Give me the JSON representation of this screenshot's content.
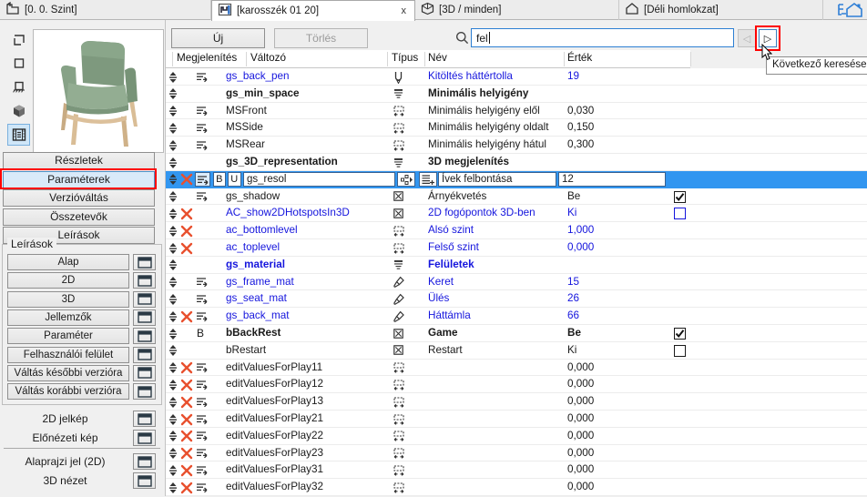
{
  "tabs": [
    {
      "label": "[0. 0. Szint]",
      "icon": "story-icon",
      "active": false
    },
    {
      "label": "[karosszék 01 20]",
      "icon": "object-icon",
      "active": true,
      "close": "x"
    },
    {
      "label": "[3D / minden]",
      "icon": "cube-icon",
      "active": false
    },
    {
      "label": "[Déli homlokzat]",
      "icon": "elevation-icon",
      "active": false
    }
  ],
  "navigator_icon": "navigator-icon",
  "sidebar": {
    "view_icons": [
      "symbol-2d-icon",
      "plan-2d-icon",
      "section-icon",
      "cube-3d-icon",
      "parameter-list-icon"
    ],
    "selected_view_icon": "parameter-list-icon",
    "preview": "armchair-preview",
    "main_buttons": [
      {
        "label": "Részletek"
      },
      {
        "label": "Paraméterek",
        "selected": true,
        "annotated": true
      },
      {
        "label": "Verzióváltás"
      },
      {
        "label": "Összetevők"
      },
      {
        "label": "Leírások"
      }
    ],
    "group_title": "Leírások",
    "group_buttons": [
      "Alap",
      "2D",
      "3D",
      "Jellemzők",
      "Paraméter",
      "Felhasználói felület",
      "Váltás későbbi verzióra",
      "Váltás korábbi verzióra"
    ],
    "bottom_labels_1": [
      "2D jelkép",
      "Előnézeti kép"
    ],
    "bottom_labels_2": [
      "Alaprajzi jel (2D)",
      "3D nézet"
    ]
  },
  "toolbar": {
    "new_label": "Új",
    "delete_label": "Törlés",
    "search_icon": "search-icon",
    "search_value": "fel",
    "prev_label": "◁",
    "next_label": "▷",
    "tooltip": "Következő keresése"
  },
  "table": {
    "headers": [
      "Megjelenítés",
      "Változó",
      "Típus",
      "Név",
      "Érték"
    ],
    "rows": [
      {
        "variable": "gs_back_pen",
        "type": "pen",
        "name": "Kitöltés háttértolla",
        "value": "19",
        "blue": true,
        "vis": true
      },
      {
        "variable": "gs_min_space",
        "type": "title",
        "name": "Minimális helyigény",
        "value": "",
        "bold": true
      },
      {
        "variable": "MSFront",
        "type": "length",
        "name": "Minimális helyigény elől",
        "value": "0,030",
        "vis": true
      },
      {
        "variable": "MSSide",
        "type": "length",
        "name": "Minimális helyigény oldalt",
        "value": "0,150",
        "vis": true
      },
      {
        "variable": "MSRear",
        "type": "length",
        "name": "Minimális helyigény hátul",
        "value": "0,300",
        "vis": true
      },
      {
        "variable": "gs_3D_representation",
        "type": "title",
        "name": "3D megjelenítés",
        "value": "",
        "bold": true
      },
      {
        "editing": true
      },
      {
        "variable": "gs_shadow",
        "type": "bool",
        "name": "Árnyékvetés",
        "value": "Be",
        "vis": true,
        "checkbox": "checked"
      },
      {
        "variable": "AC_show2DHotspotsIn3D",
        "type": "bool",
        "name": "2D fogópontok 3D-ben",
        "value": "Ki",
        "blue": true,
        "del": true,
        "checkbox": "unchecked-blue"
      },
      {
        "variable": "ac_bottomlevel",
        "type": "length",
        "name": "Alsó szint",
        "value": "1,000",
        "blue": true,
        "del": true
      },
      {
        "variable": "ac_toplevel",
        "type": "length",
        "name": "Felső szint",
        "value": "0,000",
        "blue": true,
        "del": true
      },
      {
        "variable": "gs_material",
        "type": "title",
        "name": "Felületek",
        "value": "",
        "blue": true,
        "bold": true
      },
      {
        "variable": "gs_frame_mat",
        "type": "material",
        "name": "Keret",
        "value": "15",
        "blue": true,
        "vis": true
      },
      {
        "variable": "gs_seat_mat",
        "type": "material",
        "name": "Ülés",
        "value": "26",
        "blue": true,
        "vis": true
      },
      {
        "variable": "gs_back_mat",
        "type": "material",
        "name": "Háttámla",
        "value": "66",
        "blue": true,
        "del": true,
        "vis": true
      },
      {
        "variable": "bBackRest",
        "type": "bool",
        "name": "Game",
        "value": "Be",
        "bold": true,
        "marker": "B",
        "checkbox": "checked"
      },
      {
        "variable": "bRestart",
        "type": "bool",
        "name": "Restart",
        "value": "Ki",
        "checkbox": "unchecked"
      },
      {
        "variable": "editValuesForPlay11",
        "type": "length",
        "name": "",
        "value": "0,000",
        "del": true,
        "vis": true
      },
      {
        "variable": "editValuesForPlay12",
        "type": "length",
        "name": "",
        "value": "0,000",
        "del": true,
        "vis": true
      },
      {
        "variable": "editValuesForPlay13",
        "type": "length",
        "name": "",
        "value": "0,000",
        "del": true,
        "vis": true
      },
      {
        "variable": "editValuesForPlay21",
        "type": "length",
        "name": "",
        "value": "0,000",
        "del": true,
        "vis": true
      },
      {
        "variable": "editValuesForPlay22",
        "type": "length",
        "name": "",
        "value": "0,000",
        "del": true,
        "vis": true
      },
      {
        "variable": "editValuesForPlay23",
        "type": "length",
        "name": "",
        "value": "0,000",
        "del": true,
        "vis": true
      },
      {
        "variable": "editValuesForPlay31",
        "type": "length",
        "name": "",
        "value": "0,000",
        "del": true,
        "vis": true
      },
      {
        "variable": "editValuesForPlay32",
        "type": "length",
        "name": "",
        "value": "0,000",
        "del": true,
        "vis": true
      }
    ],
    "edit_row": {
      "variable": "gs_resol",
      "name": "Ívek felbontása",
      "value": "12",
      "bold_label": "B",
      "unique_label": "U",
      "type_icon": "integer-type-icon",
      "value_list_icon": "value-list-icon"
    }
  },
  "colors": {
    "selection_blue": "#3296f0",
    "link_blue": "#1515dd",
    "delete_red": "#e8502e",
    "annotation_red": "#ff0000"
  }
}
